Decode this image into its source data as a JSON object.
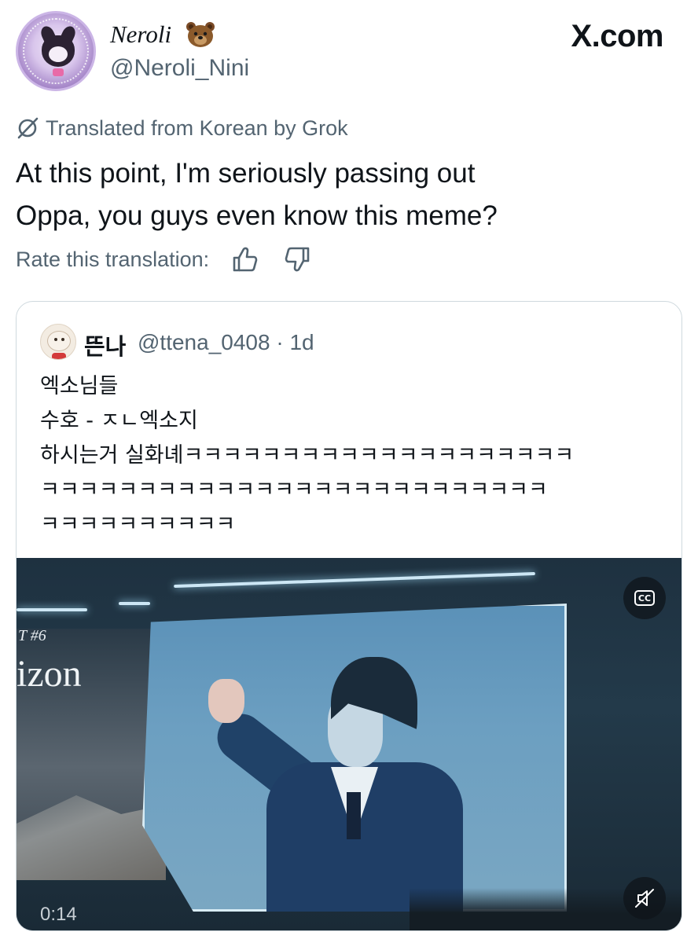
{
  "header": {
    "display_name": "Neroli",
    "badge_emoji": "bear-face",
    "handle": "@Neroli_Nini",
    "site_logo": "X.com"
  },
  "translation": {
    "label": "Translated from Korean by Grok",
    "icon": "grok-icon"
  },
  "tweet": {
    "lines": [
      "At this point, I'm seriously passing out",
      "Oppa, you guys even know this meme?"
    ]
  },
  "rating": {
    "label": "Rate this translation:",
    "thumbs_up_icon": "thumbs-up-icon",
    "thumbs_down_icon": "thumbs-down-icon"
  },
  "quoted": {
    "name": "뜬나",
    "handle": "@ttena_0408",
    "time": "· 1d",
    "lines": [
      "엑소님들",
      "수호 - ㅈㄴ엑소지",
      "하시는거 실화녜ㅋㅋㅋㅋㅋㅋㅋㅋㅋㅋㅋㅋㅋㅋㅋㅋㅋㅋㅋㅋ",
      "ㅋㅋㅋㅋㅋㅋㅋㅋㅋㅋㅋㅋㅋㅋㅋㅋㅋㅋㅋㅋㅋㅋㅋㅋㅋㅋ",
      "ㅋㅋㅋㅋㅋㅋㅋㅋㅋㅋ"
    ],
    "video": {
      "timestamp": "0:14",
      "panel_text_top": "T #6",
      "panel_text_big": "izon",
      "cc_label": "CC"
    }
  },
  "colors": {
    "text_primary": "#0f1419",
    "text_secondary": "#536471",
    "border": "#cfd9de"
  }
}
